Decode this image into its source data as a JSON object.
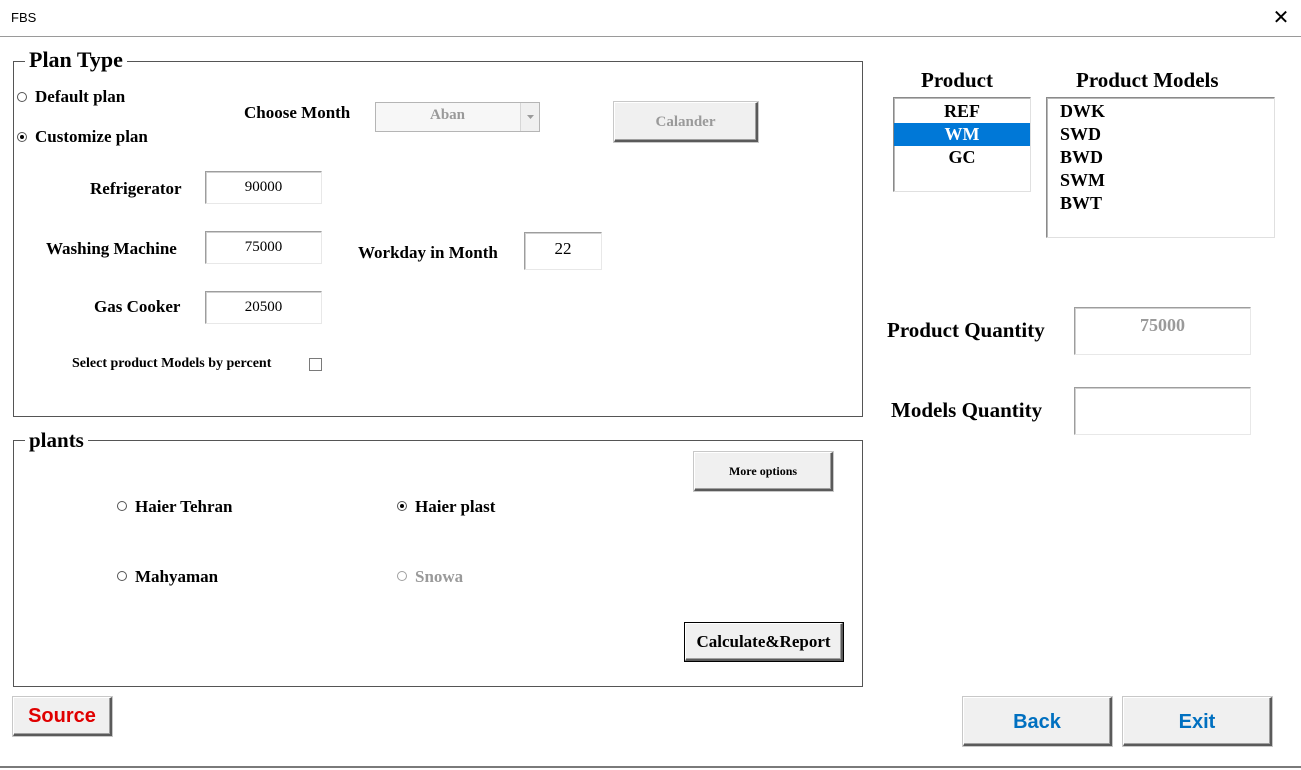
{
  "window": {
    "title": "FBS",
    "close_glyph": "✕"
  },
  "plan_type": {
    "caption": "Plan Type",
    "default_plan_label": "Default plan",
    "customize_plan_label": "Customize plan",
    "selected_plan": "Customize plan",
    "choose_month_label": "Choose Month",
    "month_value": "Aban",
    "calander_button": "Calander",
    "refrigerator_label": "Refrigerator",
    "refrigerator_value": "90000",
    "washing_machine_label": "Washing Machine",
    "washing_machine_value": "75000",
    "workday_label": "Workday in Month",
    "workday_value": "22",
    "gas_cooker_label": "Gas Cooker",
    "gas_cooker_value": "20500",
    "select_by_percent_label": "Select product Models by percent",
    "select_by_percent_checked": false
  },
  "plants": {
    "caption": "plants",
    "more_options_button": "More options",
    "options": [
      {
        "label": "Haier Tehran",
        "selected": false,
        "enabled": true
      },
      {
        "label": "Haier plast",
        "selected": true,
        "enabled": true
      },
      {
        "label": "Mahyaman",
        "selected": false,
        "enabled": true
      },
      {
        "label": "Snowa",
        "selected": false,
        "enabled": false
      }
    ],
    "calculate_button": "Calculate&Report"
  },
  "product": {
    "header": "Product",
    "items": [
      "REF",
      "WM",
      "GC"
    ],
    "selected": "WM"
  },
  "product_models": {
    "header": "Product Models",
    "items": [
      "DWK",
      "SWD",
      "BWD",
      "SWM",
      "BWT"
    ]
  },
  "quantities": {
    "product_quantity_label": "Product Quantity",
    "product_quantity_value": "75000",
    "models_quantity_label": "Models Quantity",
    "models_quantity_value": ""
  },
  "footer": {
    "source_button": "Source",
    "back_button": "Back",
    "exit_button": "Exit"
  },
  "colors": {
    "source_text": "#e00000",
    "nav_text": "#0070c0",
    "selection": "#0078d7",
    "disabled_text": "#9a9a9a"
  }
}
